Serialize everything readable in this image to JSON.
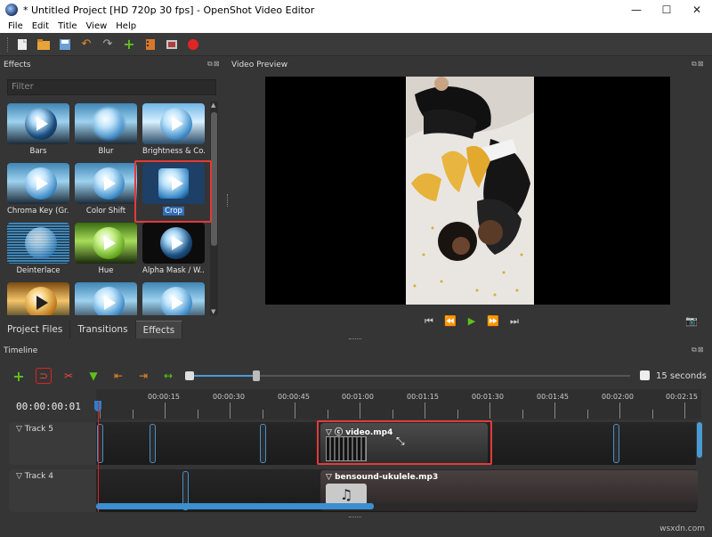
{
  "window": {
    "title": "* Untitled Project [HD 720p 30 fps] - OpenShot Video Editor",
    "minimize": "—",
    "maximize": "☐",
    "close": "✕"
  },
  "menu": [
    "File",
    "Edit",
    "Title",
    "View",
    "Help"
  ],
  "toolbar_icons": [
    "new-project-icon",
    "open-project-icon",
    "save-project-icon",
    "undo-icon",
    "redo-icon",
    "import-files-icon",
    "add-track-icon",
    "export-film-icon",
    "record-icon"
  ],
  "effects_panel": {
    "title": "Effects",
    "filter_placeholder": "Filter",
    "items": [
      {
        "label": "Bars"
      },
      {
        "label": "Blur"
      },
      {
        "label": "Brightness & Co..."
      },
      {
        "label": "Chroma Key (Gr..."
      },
      {
        "label": "Color Shift"
      },
      {
        "label": "Crop",
        "selected": true
      },
      {
        "label": "Deinterlace"
      },
      {
        "label": "Hue"
      },
      {
        "label": "Alpha Mask / W..."
      },
      {
        "label": ""
      },
      {
        "label": ""
      },
      {
        "label": ""
      }
    ],
    "tabs": [
      "Project Files",
      "Transitions",
      "Effects"
    ],
    "active_tab": "Effects"
  },
  "preview": {
    "title": "Video Preview",
    "controls": [
      "⏮",
      "⏪",
      "▶",
      "⏩",
      "⏭"
    ]
  },
  "timeline": {
    "title": "Timeline",
    "zoom_label": "15 seconds",
    "timecode": "00:00:00:01",
    "ruler_labels": [
      "00:00:15",
      "00:00:30",
      "00:00:45",
      "00:01:00",
      "00:01:15",
      "00:01:30",
      "00:01:45",
      "00:02:00",
      "00:02:15"
    ],
    "tracks": [
      {
        "name": "Track 5",
        "clip": "video.mp4"
      },
      {
        "name": "Track 4",
        "clip": "bensound-ukulele.mp3"
      }
    ]
  },
  "watermark": "wsxdn.com",
  "colors": {
    "accent": "#3c8fd0",
    "highlight": "#e23b3b",
    "play": "#5ec21a"
  }
}
